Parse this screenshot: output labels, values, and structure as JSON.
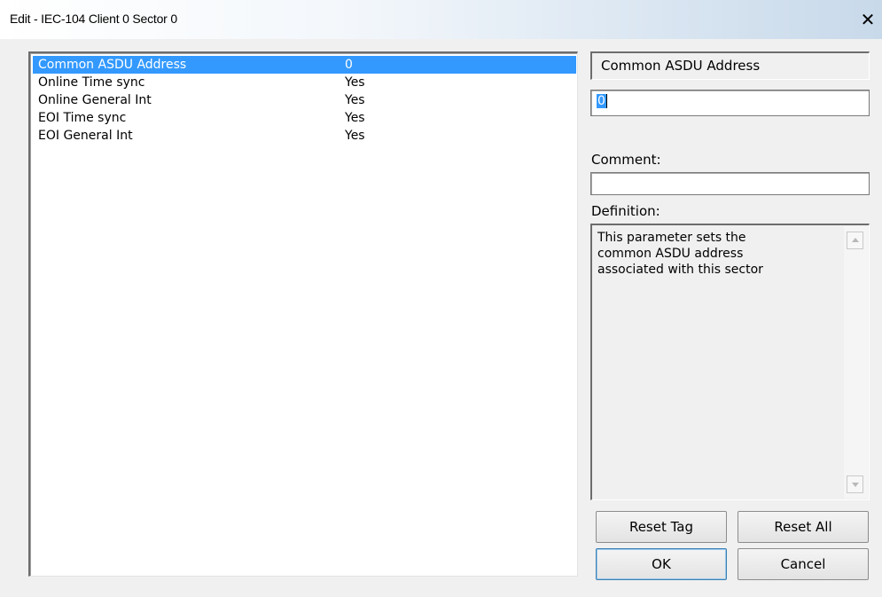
{
  "window": {
    "title": "Edit - IEC-104 Client 0 Sector 0",
    "close_label": "✕"
  },
  "params": [
    {
      "name": "Common ASDU Address",
      "value": "0",
      "selected": true
    },
    {
      "name": "Online Time sync",
      "value": "Yes",
      "selected": false
    },
    {
      "name": "Online General Int",
      "value": "Yes",
      "selected": false
    },
    {
      "name": "EOI Time sync",
      "value": "Yes",
      "selected": false
    },
    {
      "name": "EOI General Int",
      "value": "Yes",
      "selected": false
    }
  ],
  "editor": {
    "param_name": "Common ASDU Address",
    "value": "0",
    "comment_label": "Comment:",
    "comment_value": "",
    "definition_label": "Definition:",
    "definition_text": "This parameter sets the\ncommon ASDU address\nassociated with this sector"
  },
  "buttons": {
    "reset_tag": "Reset Tag",
    "reset_all": "Reset All",
    "ok": "OK",
    "cancel": "Cancel"
  },
  "colors": {
    "selection": "#3399ff",
    "dialog_bg": "#f0f0f0"
  }
}
